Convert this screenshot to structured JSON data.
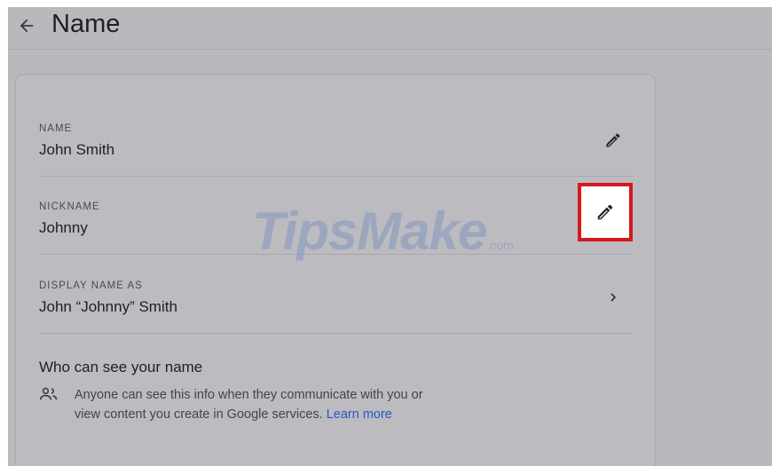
{
  "header": {
    "title": "Name"
  },
  "rows": [
    {
      "label": "NAME",
      "value": "John Smith"
    },
    {
      "label": "NICKNAME",
      "value": "Johnny"
    },
    {
      "label": "DISPLAY NAME AS",
      "value": "John “Johnny” Smith"
    }
  ],
  "visibility": {
    "title": "Who can see your name",
    "text": "Anyone can see this info when they communicate with you or view content you create in Google services.",
    "link": "Learn more"
  },
  "watermark": {
    "brand": "TipsMake",
    "suffix": ".com"
  },
  "colors": {
    "highlight": "#d5191e",
    "link": "#2a56c6",
    "background": "#b9b8bd"
  }
}
